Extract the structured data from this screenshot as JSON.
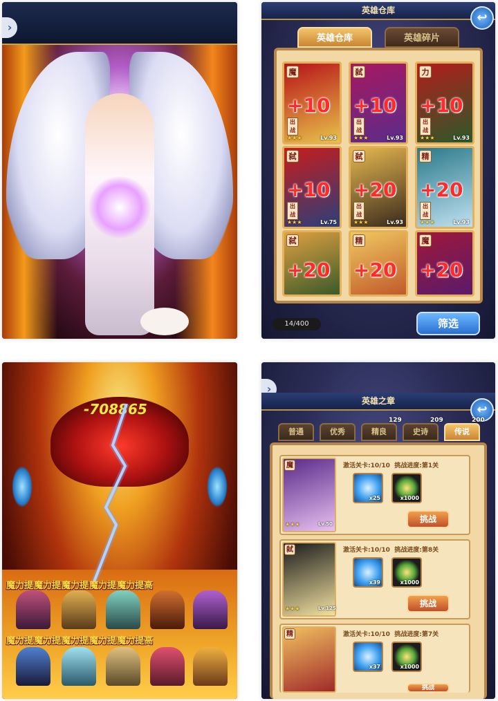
{
  "panels": {
    "angel": {
      "expand_glyph": "›"
    },
    "warehouse": {
      "title": "英雄仓库",
      "tabs": [
        "英雄仓库",
        "英雄碎片"
      ],
      "back_glyph": "↩",
      "cards": [
        {
          "faction": "魔",
          "bonus": "+10",
          "battle": "出战",
          "stars": "★★★",
          "level": "Lv.93",
          "colors": [
            "#b8121a",
            "#e8c24a"
          ]
        },
        {
          "faction": "弑",
          "bonus": "+10",
          "battle": "出战",
          "stars": "★★★",
          "level": "Lv.93",
          "colors": [
            "#a81860",
            "#5a2c8a"
          ]
        },
        {
          "faction": "力",
          "bonus": "+10",
          "battle": "出战",
          "stars": "★★★",
          "level": "Lv.93",
          "colors": [
            "#b41c1c",
            "#2c5a2a"
          ]
        },
        {
          "faction": "弑",
          "bonus": "+10",
          "battle": "出战",
          "stars": "★★★",
          "level": "Lv.75",
          "colors": [
            "#c81c1c",
            "#2a3f7a"
          ]
        },
        {
          "faction": "弑",
          "bonus": "+20",
          "battle": "出战",
          "stars": "★★★",
          "level": "Lv.93",
          "colors": [
            "#e6b850",
            "#3a2a1c"
          ]
        },
        {
          "faction": "精",
          "bonus": "+20",
          "battle": "出战",
          "stars": "★★★",
          "level": "Lv.93",
          "colors": [
            "#2a7a8a",
            "#c0e0f0"
          ]
        },
        {
          "faction": "弑",
          "bonus": "+20",
          "battle": "",
          "stars": "",
          "level": "",
          "colors": [
            "#e0a040",
            "#3a5a2a"
          ]
        },
        {
          "faction": "精",
          "bonus": "+20",
          "battle": "",
          "stars": "",
          "level": "",
          "colors": [
            "#f0c860",
            "#c05a2a"
          ]
        },
        {
          "faction": "魔",
          "bonus": "+20",
          "battle": "",
          "stars": "",
          "level": "",
          "colors": [
            "#a0183a",
            "#5a1a6a"
          ]
        }
      ],
      "counter": "14/400",
      "filter_label": "筛选"
    },
    "battle": {
      "damage": "-708865",
      "buff_text": "魔力提",
      "buff_row1": [
        "魔力提",
        "魔力提",
        "魔力提",
        "魔力提",
        "魔力提高"
      ],
      "buff_row2": [
        "魔力提",
        "魔力提",
        "魔力提",
        "魔力提",
        "魔力提高"
      ]
    },
    "chapter": {
      "expand_glyph": "›",
      "title": "英雄之章",
      "back_glyph": "↩",
      "rarity_tabs": [
        {
          "label": "普通",
          "count": ""
        },
        {
          "label": "优秀",
          "count": ""
        },
        {
          "label": "精良",
          "count": "129"
        },
        {
          "label": "史诗",
          "count": "209"
        },
        {
          "label": "传说",
          "count": "200"
        }
      ],
      "rows": [
        {
          "faction": "魔",
          "stage": "激活关卡:10/10",
          "progress": "挑战进度:第1关",
          "gem_qty": "x25",
          "medal_qty": "x1000",
          "challenge": "挑战",
          "stars": "★★★",
          "level": "Lv.50",
          "colors": [
            "#5a2a8a",
            "#e8c0f0"
          ]
        },
        {
          "faction": "弑",
          "stage": "激活关卡:10/10",
          "progress": "挑战进度:第8关",
          "gem_qty": "x39",
          "medal_qty": "x1000",
          "challenge": "挑战",
          "stars": "★★★",
          "level": "Lv.125",
          "colors": [
            "#1c1c1c",
            "#f0e0a0"
          ]
        },
        {
          "faction": "精",
          "stage": "激活关卡:10/10",
          "progress": "挑战进度:第7关",
          "gem_qty": "x37",
          "medal_qty": "x1000",
          "challenge": "挑战",
          "stars": "",
          "level": "",
          "colors": [
            "#f0c060",
            "#a02a2a"
          ]
        }
      ]
    }
  },
  "colors": {
    "gold_border": "#b6874a",
    "bonus_red": "#ff2a2a",
    "button_blue": "#2a6fd0"
  }
}
